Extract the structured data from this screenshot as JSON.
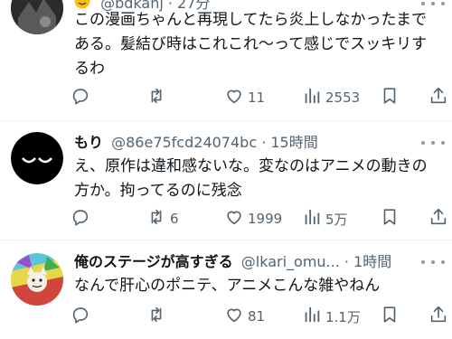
{
  "tweets": [
    {
      "handle_time": "@bdkanj · 27分",
      "text": "この漫画ちゃんと再現してたら炎上しなかったまである。髪結び時はこれこれ〜って感じでスッキリするわ",
      "reply_count": "",
      "retweet_count": "",
      "like_count": "11",
      "view_count": "2553"
    },
    {
      "name": "もり",
      "handle_time": "@86e75fcd24074bc · 15時間",
      "text": "え、原作は違和感ないな。変なのはアニメの動きの方か。拘ってるのに残念",
      "reply_count": "",
      "retweet_count": "6",
      "like_count": "1999",
      "view_count": "5万"
    },
    {
      "name": "俺のステージが高すぎる",
      "handle_time": "@lkari_omu... · 1時間",
      "text": "なんで肝心のポニテ、アニメこんな雑やねん",
      "reply_count": "",
      "retweet_count": "",
      "like_count": "81",
      "view_count": "1.1万"
    }
  ],
  "icons": {
    "reply": "reply-icon",
    "retweet": "retweet-icon",
    "like": "heart-icon",
    "views": "views-icon",
    "bookmark": "bookmark-icon",
    "share": "share-icon",
    "more": "more-icon",
    "emoji": "smile-emoji-icon"
  },
  "colors": {
    "text": "#0f1419",
    "secondary": "#536471",
    "divider": "#eff3f4",
    "emoji": "#f5c116"
  }
}
